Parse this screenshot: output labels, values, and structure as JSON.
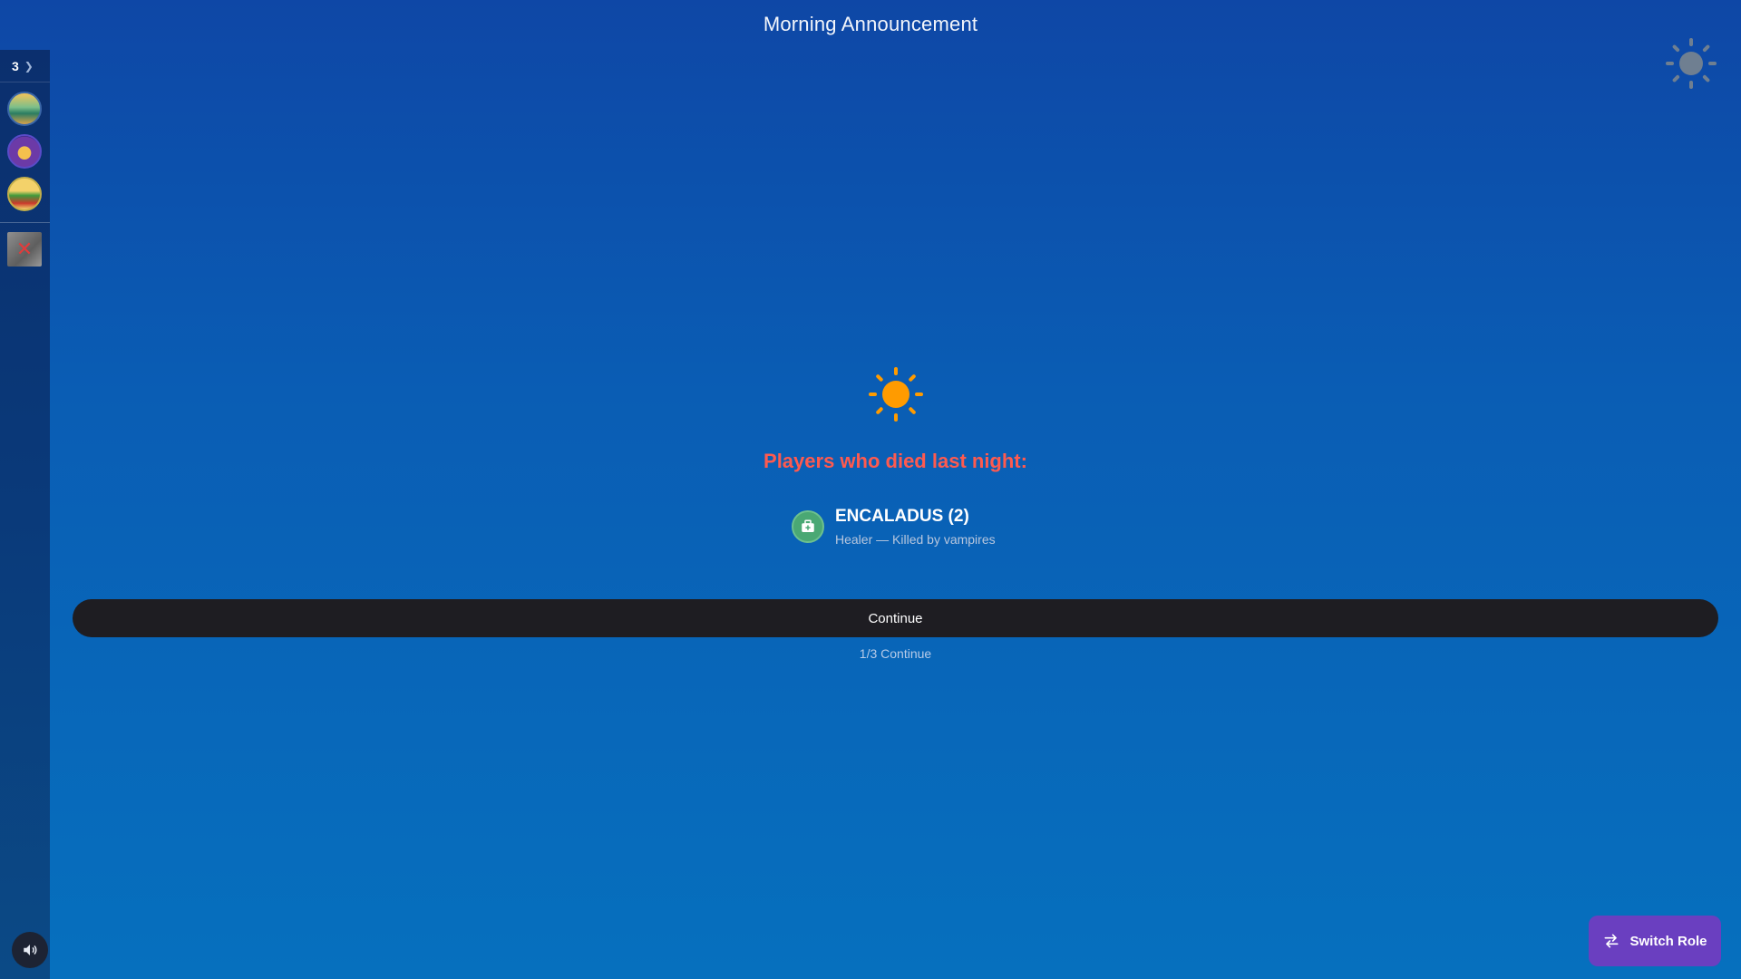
{
  "header": {
    "title": "Morning Announcement"
  },
  "sidebar": {
    "count": "3",
    "avatars": [
      {
        "name": "player-avatar-1"
      },
      {
        "name": "player-avatar-2"
      },
      {
        "name": "player-avatar-3"
      }
    ]
  },
  "announcement": {
    "died_title": "Players who died last night:",
    "victims": [
      {
        "name": "ENCALADUS (2)",
        "detail": "Healer — Killed by vampires"
      }
    ]
  },
  "actions": {
    "continue_label": "Continue",
    "progress": "1/3 Continue",
    "switch_role_label": "Switch Role"
  },
  "colors": {
    "died_title": "#ff5a4f",
    "switch_role_bg": "#6a3fc0",
    "continue_bg": "#1e1d22",
    "sun": "#ff9b00"
  }
}
